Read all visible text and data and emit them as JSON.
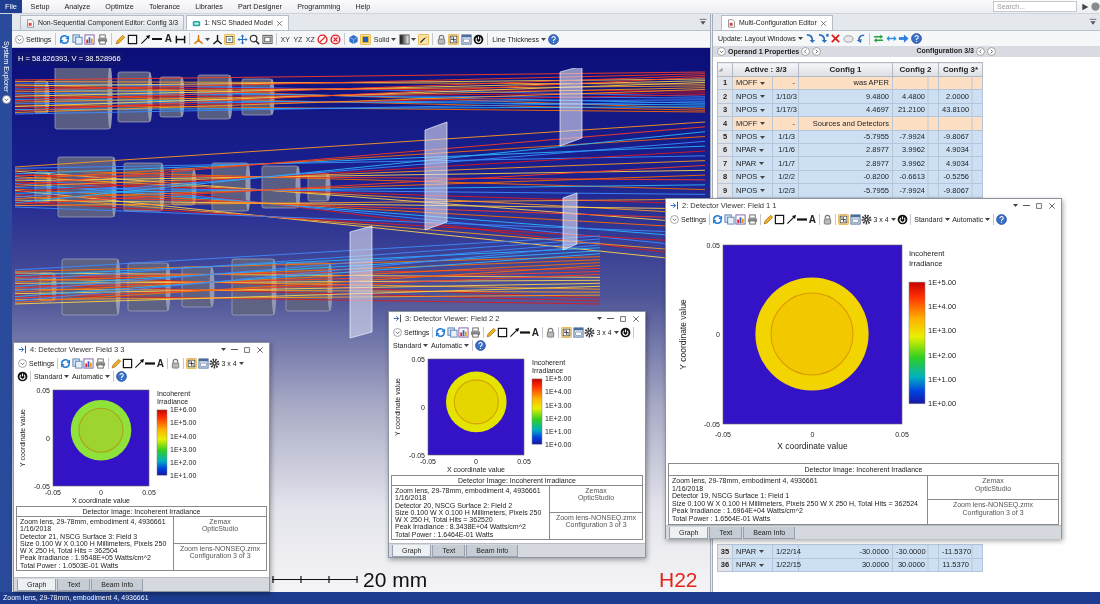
{
  "menu": {
    "file": "File",
    "items": [
      "Setup",
      "Analyze",
      "Optimize",
      "Tolerance",
      "Libraries",
      "Part Designer",
      "Programming",
      "Help"
    ],
    "search": {
      "placeholder": "Search..."
    }
  },
  "system_explorer": {
    "label": "System Explorer"
  },
  "layout_pane": {
    "tabs": [
      {
        "label": "Non-Sequential Component Editor: Config 3/3",
        "selected": false
      },
      {
        "label": "1: NSC Shaded Model",
        "selected": true
      }
    ],
    "toolbar": {
      "settings": "Settings",
      "text_tool": "A",
      "views": [
        "XY",
        "YZ",
        "XZ"
      ],
      "render_mode": "Solid",
      "line_thickness": "Line Thickness",
      "toggles": [
        {
          "on": true
        },
        {
          "on": true
        },
        {
          "on": true
        },
        {
          "on": true
        }
      ]
    },
    "coordinates": "H = 58.826393, V = 38.528966",
    "scale_label": "20 mm",
    "corner_label": "H22"
  },
  "mce": {
    "tabs": [
      {
        "label": "Multi-Configuration Editor",
        "selected": true
      }
    ],
    "toolbar": {
      "update": "Update: Layout Windows"
    },
    "operand_properties": "Operand 1 Properties",
    "configuration": "Configuration 3/3",
    "columns": [
      "Active : 3/3",
      "Config 1",
      "Config 2",
      "Config 3*"
    ],
    "rows": [
      {
        "number": "1",
        "kind": "comment",
        "operand": "MOFF",
        "parameter": "-",
        "comment": "was APER"
      },
      {
        "number": "2",
        "kind": "operand",
        "operand": "NPOS",
        "parameter": "1/10/3",
        "values": [
          "9.4800",
          "4.4800",
          "2.0000"
        ]
      },
      {
        "number": "3",
        "kind": "operand",
        "operand": "NPOS",
        "parameter": "1/17/3",
        "values": [
          "4.4697",
          "21.2100",
          "43.8100"
        ]
      },
      {
        "number": "4",
        "kind": "comment",
        "operand": "MOFF",
        "parameter": "-",
        "comment": "Sources and Detectors"
      },
      {
        "number": "5",
        "kind": "operand",
        "operand": "NPOS",
        "parameter": "1/1/3",
        "values": [
          "-5.7955",
          "-7.9924",
          "-9.8067"
        ]
      },
      {
        "number": "6",
        "kind": "operand",
        "operand": "NPAR",
        "parameter": "1/1/6",
        "values": [
          "2.8977",
          "3.9962",
          "4.9034"
        ]
      },
      {
        "number": "7",
        "kind": "operand",
        "operand": "NPAR",
        "parameter": "1/1/7",
        "values": [
          "2.8977",
          "3.9962",
          "4.9034"
        ]
      },
      {
        "number": "8",
        "kind": "operand",
        "operand": "NPOS",
        "parameter": "1/2/2",
        "values": [
          "-0.8200",
          "-0.6613",
          "-0.5256"
        ]
      },
      {
        "number": "9",
        "kind": "operand",
        "operand": "NPOS",
        "parameter": "1/2/3",
        "values": [
          "-5.7955",
          "-7.9924",
          "-9.8067"
        ]
      }
    ],
    "bottom_rows": [
      {
        "number": "35",
        "kind": "operand",
        "operand": "NPAR",
        "parameter": "1/22/14",
        "values": [
          "-30.0000",
          "-30.0000",
          "-11.5370"
        ]
      },
      {
        "number": "36",
        "kind": "operand",
        "operand": "NPAR",
        "parameter": "1/22/15",
        "values": [
          "30.0000",
          "30.0000",
          "11.5370"
        ]
      }
    ]
  },
  "detector_windows": [
    {
      "title": "2: Detector Viewer: Field 1 1",
      "toolbar": {
        "settings": "Settings",
        "text_tool": "A",
        "layout": "3 x 4",
        "display": "Standard",
        "scale": "Automatic",
        "toggles": [
          {
            "on": true
          }
        ]
      },
      "plot": {
        "y_ticks": [
          "0.05",
          "0",
          "-0.05"
        ],
        "x_ticks": [
          "-0.05",
          "0",
          "0.05"
        ],
        "x_label": "X coordinate value",
        "y_label": "Y coordinate value",
        "legend_title": "Incoherent Irradiance",
        "colorbar_labels": [
          "1E+5.00",
          "1E+4.00",
          "1E+3.00",
          "1E+2.00",
          "1E+1.00",
          "1E+0.00"
        ],
        "color": "#f2d400"
      },
      "info": {
        "title": "Detector Image: Incoherent Irradiance",
        "lines": [
          "Zoom lens, 29-78mm, embodiment 4, 4936661",
          "1/16/2018",
          "Detector 19, NSCG Surface 1: Field 1",
          "Size 0.100 W X 0.100 H Millimeters, Pixels 250 W X 250 H, Total Hits = 362524",
          "Peak Irradiance : 1.6964E+04 Watts/cm^2",
          "Total Power : 1.6564E-01 Watts"
        ],
        "program": [
          "Zemax",
          "OpticStudio"
        ],
        "file": [
          "Zoom lens-NONSEQ.zmx",
          "Configuration 3 of 3"
        ]
      },
      "tabs": [
        {
          "label": "Graph",
          "selected": true
        },
        {
          "label": "Text",
          "selected": false
        },
        {
          "label": "Beam Info",
          "selected": false
        }
      ]
    },
    {
      "title": "3: Detector Viewer: Field 2 2",
      "toolbar": {
        "settings": "Settings",
        "text_tool": "A",
        "layout": "3 x 4",
        "display": "Standard",
        "scale": "Automatic",
        "toggles": [
          {
            "on": true
          }
        ]
      },
      "plot": {
        "y_ticks": [
          "0.05",
          "0",
          "-0.05"
        ],
        "x_ticks": [
          "-0.05",
          "0",
          "0.05"
        ],
        "x_label": "X coordinate value",
        "y_label": "Y coordinate value",
        "legend_title": "Incoherent Irradiance",
        "colorbar_labels": [
          "1E+5.00",
          "1E+4.00",
          "1E+3.00",
          "1E+2.00",
          "1E+1.00",
          "1E+0.00"
        ],
        "color": "#e4e400"
      },
      "info": {
        "title": "Detector Image: Incoherent Irradiance",
        "lines": [
          "Zoom lens, 29-78mm, embodiment 4, 4936661",
          "1/16/2018",
          "Detector 20, NSCG Surface 2: Field 2",
          "Size 0.100 W X 0.100 H Millimeters, Pixels 250 W X 250 H, Total Hits = 362520",
          "Peak Irradiance : 8.3438E+04 Watts/cm^2",
          "Total Power : 1.6464E-01 Watts"
        ],
        "program": [
          "Zemax",
          "OpticStudio"
        ],
        "file": [
          "Zoom lens-NONSEQ.zmx",
          "Configuration 3 of 3"
        ]
      },
      "tabs": [
        {
          "label": "Graph",
          "selected": true
        },
        {
          "label": "Text",
          "selected": false
        },
        {
          "label": "Beam Info",
          "selected": false
        }
      ]
    },
    {
      "title": "4: Detector Viewer: Field 3 3",
      "toolbar": {
        "settings": "Settings",
        "text_tool": "A",
        "layout": "3 x 4",
        "display": "Standard",
        "scale": "Automatic",
        "toggles": [
          {
            "on": true
          }
        ]
      },
      "plot": {
        "y_ticks": [
          "0.05",
          "0",
          "-0.05"
        ],
        "x_ticks": [
          "-0.05",
          "0",
          "0.05"
        ],
        "x_label": "X coordinate value",
        "y_label": "Y coordinate value",
        "legend_title": "Incoherent Irradiance",
        "colorbar_labels": [
          "1E+6.00",
          "1E+5.00",
          "1E+4.00",
          "1E+3.00",
          "1E+2.00",
          "1E+1.00"
        ],
        "color": "#8ee23a"
      },
      "info": {
        "title": "Detector Image: Incoherent Irradiance",
        "lines": [
          "Zoom lens, 29-78mm, embodiment 4, 4936661",
          "1/16/2018",
          "Detector 21, NSCG Surface 3: Field 3",
          "Size 0.100 W X 0.100 H Millimeters, Pixels 250 W X 250 H, Total Hits = 362504",
          "Peak Irradiance : 1.9548E+05 Watts/cm^2",
          "Total Power : 1.0503E-01 Watts"
        ],
        "program": [
          "Zemax",
          "OpticStudio"
        ],
        "file": [
          "Zoom lens-NONSEQ.zmx",
          "Configuration 3 of 3"
        ]
      },
      "tabs": [
        {
          "label": "Graph",
          "selected": true
        },
        {
          "label": "Text",
          "selected": false
        },
        {
          "label": "Beam Info",
          "selected": false
        }
      ]
    }
  ],
  "status_bar": {
    "text": "Zoom lens, 29-78mm, embodiment 4, 4936661"
  }
}
